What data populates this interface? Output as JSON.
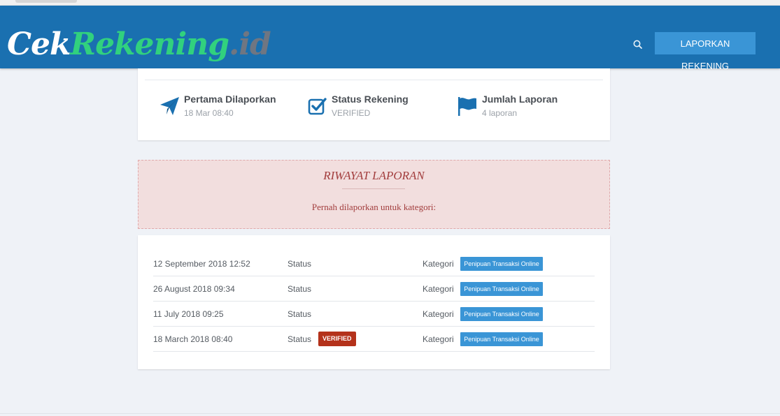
{
  "header": {
    "logo": {
      "part1": "Cek",
      "part2": "Rekening",
      "part3": ".id"
    },
    "search_icon": "search-icon",
    "report_button": "LAPORKAN REKENING"
  },
  "stats": [
    {
      "icon": "paper-plane-icon",
      "label": "Pertama Dilaporkan",
      "value": "18 Mar 08:40"
    },
    {
      "icon": "checkbox-icon",
      "label": "Status Rekening",
      "value": "VERIFIED"
    },
    {
      "icon": "flag-icon",
      "label": "Jumlah Laporan",
      "value": "4 laporan"
    }
  ],
  "history": {
    "title": "RIWAYAT LAPORAN",
    "subtitle": "Pernah dilaporkan untuk kategori:"
  },
  "reports": {
    "status_label": "Status",
    "category_label": "Kategori",
    "rows": [
      {
        "date": "12 September 2018 12:52",
        "status_badge": "",
        "category": "Penipuan Transaksi Online"
      },
      {
        "date": "26 August 2018 09:34",
        "status_badge": "",
        "category": "Penipuan Transaksi Online"
      },
      {
        "date": "11 July 2018 09:25",
        "status_badge": "",
        "category": "Penipuan Transaksi Online"
      },
      {
        "date": "18 March 2018 08:40",
        "status_badge": "VERIFIED",
        "category": "Penipuan Transaksi Online"
      }
    ]
  },
  "colors": {
    "navbar": "#1a70b0",
    "accent_button": "#3a95d6",
    "verified_badge": "#b4321b",
    "history_bg": "#f2dede",
    "history_text": "#a23d3d",
    "logo_green": "#31d17e"
  }
}
